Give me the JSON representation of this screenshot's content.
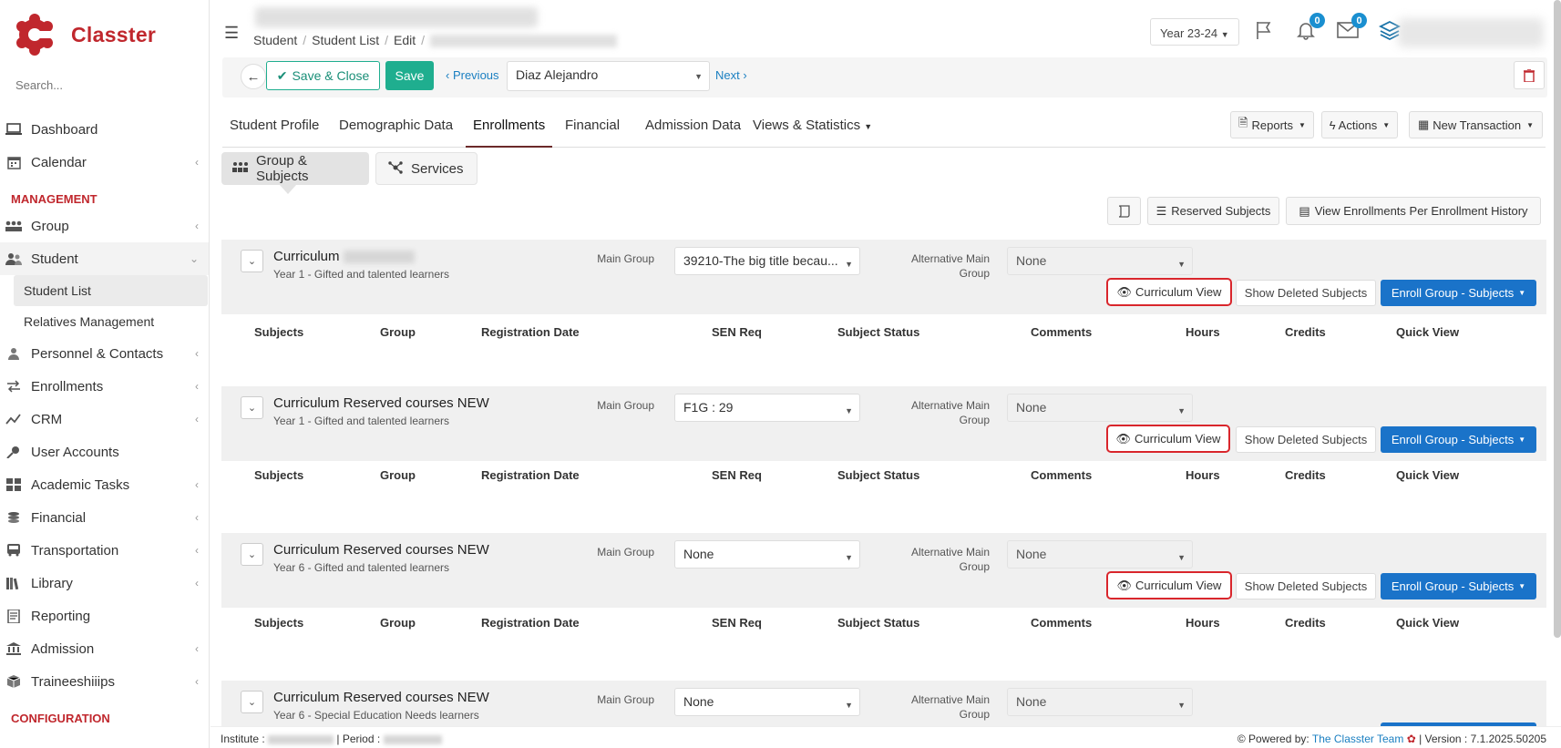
{
  "app": {
    "name": "Classter",
    "brand_color": "#c0272d",
    "accent_color": "#1fae8f",
    "link_color": "#1a7fc1"
  },
  "sidebar": {
    "search_placeholder": "Search...",
    "items_top": [
      {
        "label": "Dashboard",
        "icon": "laptop-icon"
      },
      {
        "label": "Calendar",
        "icon": "calendar-icon"
      }
    ],
    "management_heading": "MANAGEMENT",
    "group": {
      "label": "Group",
      "icon": "group-icon"
    },
    "student": {
      "label": "Student",
      "icon": "users-icon"
    },
    "student_sub": [
      "Student List",
      "Relatives Management"
    ],
    "items_rest": [
      {
        "label": "Personnel & Contacts",
        "icon": "person-icon"
      },
      {
        "label": "Enrollments",
        "icon": "exchange-icon"
      },
      {
        "label": "CRM",
        "icon": "crm-icon"
      },
      {
        "label": "User Accounts",
        "icon": "key-icon"
      },
      {
        "label": "Academic Tasks",
        "icon": "grid-icon"
      },
      {
        "label": "Financial",
        "icon": "coins-icon"
      },
      {
        "label": "Transportation",
        "icon": "bus-icon"
      },
      {
        "label": "Library",
        "icon": "library-icon"
      },
      {
        "label": "Reporting",
        "icon": "report-icon"
      },
      {
        "label": "Admission",
        "icon": "institution-icon"
      },
      {
        "label": "Traineeshiiips",
        "icon": "cube-icon"
      }
    ],
    "configuration_heading": "CONFIGURATION"
  },
  "header": {
    "breadcrumb": [
      "Student",
      "Student List",
      "Edit"
    ],
    "year": "Year 23-24",
    "notifications_count": "0",
    "messages_count": "0"
  },
  "actionbar": {
    "save_close": "Save & Close",
    "save": "Save",
    "previous": "Previous",
    "student_name": "Diaz Alejandro",
    "next": "Next"
  },
  "tabs": [
    "Student Profile",
    "Demographic Data",
    "Enrollments",
    "Financial",
    "Admission Data",
    "Views & Statistics"
  ],
  "right_buttons": {
    "reports": "Reports",
    "actions": "Actions",
    "new_transaction": "New Transaction"
  },
  "subtabs": {
    "group_subjects": "Group & Subjects",
    "services": "Services"
  },
  "toolbar": {
    "reserved_subjects": "Reserved Subjects",
    "view_history": "View Enrollments Per Enrollment History"
  },
  "labels": {
    "main_group": "Main Group",
    "alt_main_group": "Alternative Main Group",
    "curriculum_view": "Curriculum View",
    "show_deleted": "Show Deleted Subjects",
    "enroll": "Enroll Group - Subjects"
  },
  "columns": [
    "Subjects",
    "Group",
    "Registration Date",
    "SEN Req",
    "Subject Status",
    "Comments",
    "Hours",
    "Credits",
    "Quick View"
  ],
  "sections": [
    {
      "title": "Curriculum",
      "subtitle": "Year 1 - Gifted and talented learners",
      "main_group": "39210-The big title becau...",
      "alt_group": "None"
    },
    {
      "title": "Curriculum Reserved courses NEW",
      "subtitle": "Year 1 - Gifted and talented learners",
      "main_group": "F1G : 29",
      "alt_group": "None"
    },
    {
      "title": "Curriculum Reserved courses NEW",
      "subtitle": "Year 6 - Gifted and talented learners",
      "main_group": "None",
      "alt_group": "None"
    },
    {
      "title": "Curriculum Reserved courses NEW",
      "subtitle": "Year 6 - Special Education Needs learners",
      "main_group": "None",
      "alt_group": "None"
    }
  ],
  "footer": {
    "institute_label": "Institute :",
    "period_label": "| Period :",
    "powered_by": "Powered by:",
    "team": "The Classter Team",
    "version": "| Version : 7.1.2025.50205"
  }
}
